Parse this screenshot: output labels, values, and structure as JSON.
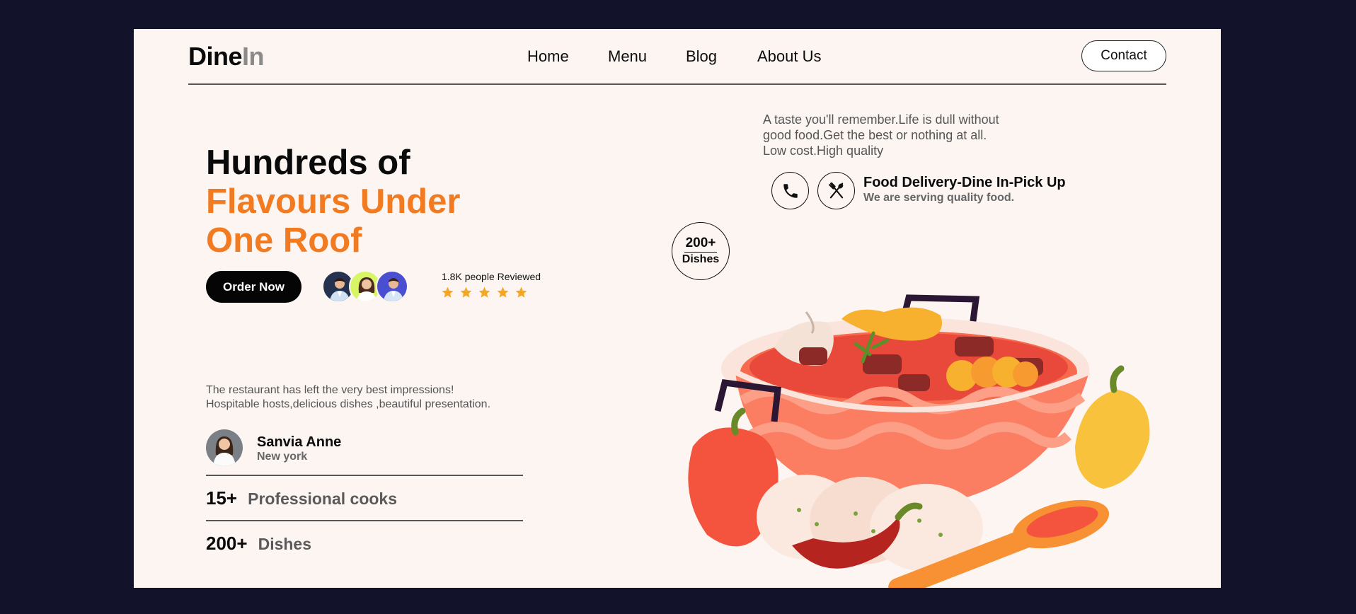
{
  "header": {
    "logo_part1": "Dine",
    "logo_part2": "In",
    "nav": [
      "Home",
      "Menu",
      "Blog",
      "About Us"
    ],
    "contact_label": "Contact"
  },
  "hero": {
    "title_line1": "Hundreds of",
    "title_line2": "Flavours Under",
    "title_line3": "One Roof",
    "order_label": "Order Now",
    "reviews_text": "1.8K people Reviewed",
    "rating_stars": 5
  },
  "testimonial": {
    "line1": "The restaurant has left the very best impressions!",
    "line2": "Hospitable hosts,delicious dishes ,beautiful presentation.",
    "name": "Sanvia Anne",
    "city": "New york"
  },
  "stats": [
    {
      "num": "15+",
      "label": "Professional cooks"
    },
    {
      "num": "200+",
      "label": "Dishes"
    }
  ],
  "info": {
    "tagline_line1": "A taste you'll remember.Life is dull without",
    "tagline_line2": "good food.Get the best or nothing at all.",
    "tagline_line3": "Low cost.High quality",
    "service_title": "Food Delivery-Dine In-Pick Up",
    "service_sub": "We are serving quality food."
  },
  "badge": {
    "number": "200+",
    "label": "Dishes"
  },
  "colors": {
    "accent": "#f27b22",
    "page_bg": "#fcf5f2",
    "outer_bg": "#12122a",
    "star": "#f5a623"
  },
  "icons": [
    "phone-icon",
    "fork-spoon-icon",
    "star-icon"
  ]
}
